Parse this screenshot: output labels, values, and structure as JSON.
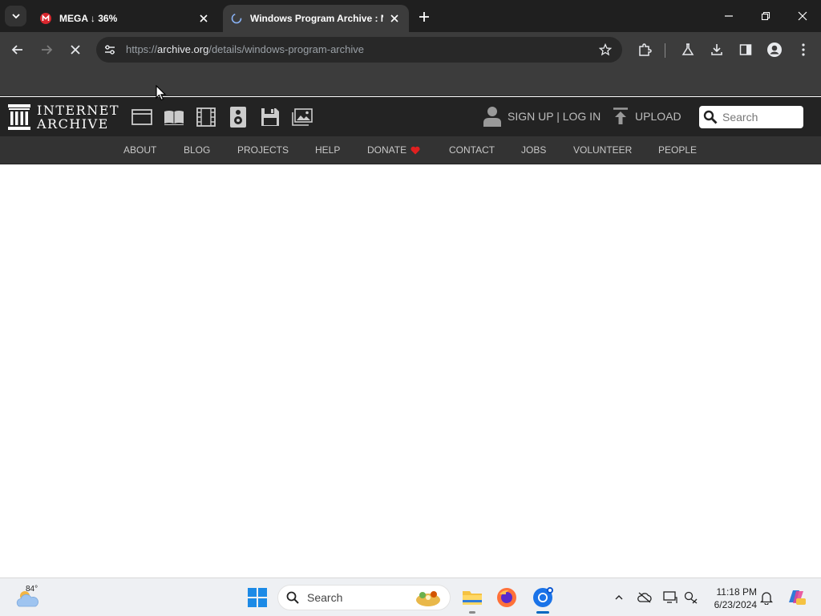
{
  "browser": {
    "tabs": [
      {
        "title": "MEGA ↓ 36%",
        "active": false,
        "favicon": "mega-icon"
      },
      {
        "title": "Windows Program Archive : NI",
        "active": true,
        "favicon": "loading-globe-icon"
      }
    ],
    "url_prefix": "https://",
    "url_host": "archive.org",
    "url_path": "/details/windows-program-archive",
    "loading": true
  },
  "archive": {
    "logo_line1": "INTERNET",
    "logo_line2": "ARCHIVE",
    "media_icons": [
      "web-icon",
      "texts-icon",
      "video-icon",
      "audio-icon",
      "software-icon",
      "images-icon"
    ],
    "auth_text": "SIGN UP | LOG IN",
    "upload_text": "UPLOAD",
    "search_placeholder": "Search",
    "nav": [
      "ABOUT",
      "BLOG",
      "PROJECTS",
      "HELP",
      "DONATE",
      "CONTACT",
      "JOBS",
      "VOLUNTEER",
      "PEOPLE"
    ]
  },
  "taskbar": {
    "temperature": "84°",
    "search_label": "Search",
    "time": "11:18 PM",
    "date": "6/23/2024"
  },
  "colors": {
    "chrome_dark": "#1f1f1f",
    "chrome_toolbar": "#3c3c3c",
    "ia_header": "#232323",
    "ia_nav": "#333333",
    "donate_heart": "#e02020",
    "accent_blue": "#0067c0"
  }
}
